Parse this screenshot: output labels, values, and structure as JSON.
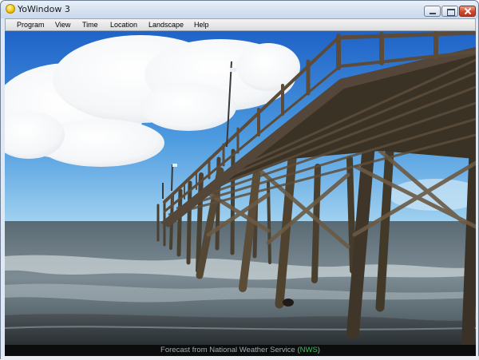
{
  "window": {
    "title": "YoWindow 3",
    "buttons": {
      "minimize": "minimize-icon",
      "maximize": "maximize-icon",
      "close": "close-icon"
    }
  },
  "menu": {
    "items": [
      {
        "label": "Program"
      },
      {
        "label": "View"
      },
      {
        "label": "Time"
      },
      {
        "label": "Location"
      },
      {
        "label": "Landscape"
      },
      {
        "label": "Help"
      }
    ]
  },
  "status": {
    "prefix": "Forecast from National Weather Service (",
    "link": "NWS",
    "suffix": ")"
  },
  "colors": {
    "sky_top": "#1f63c8",
    "sky_bottom": "#a5d4f0",
    "sea": "#6d7b84",
    "link": "#38c25a"
  }
}
